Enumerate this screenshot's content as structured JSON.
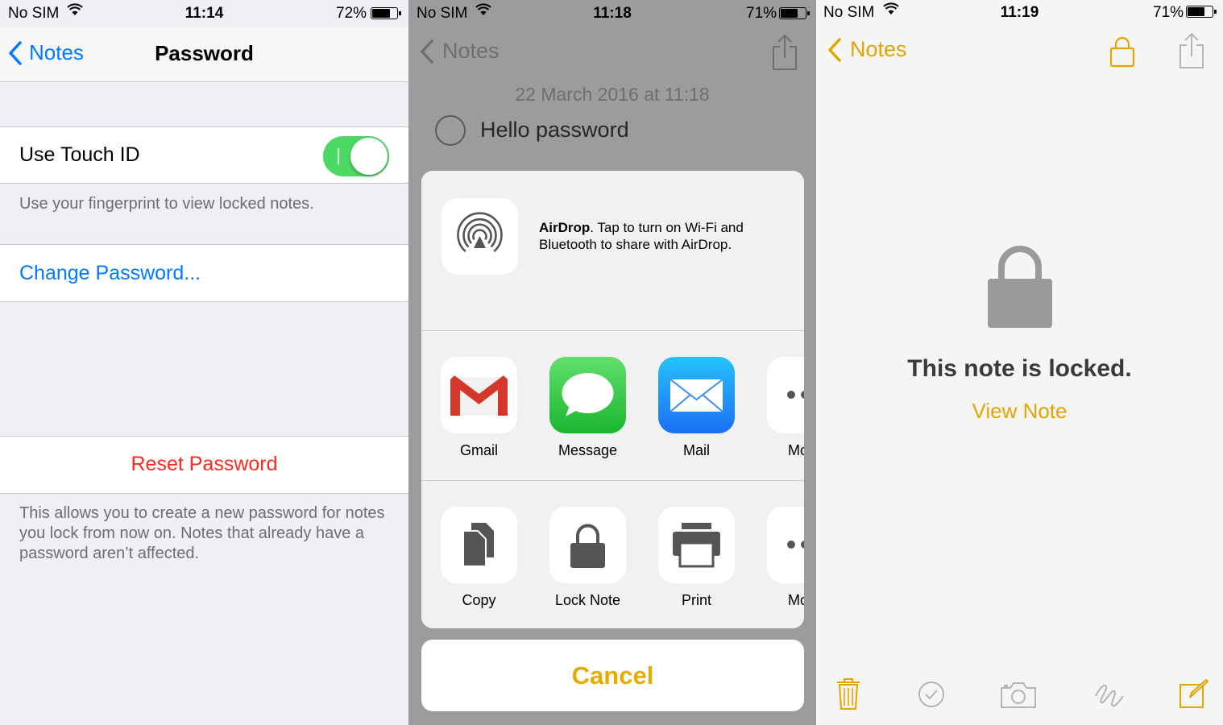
{
  "panel1": {
    "status": {
      "carrier": "No SIM",
      "time": "11:14",
      "battery": "72%"
    },
    "nav": {
      "back": "Notes",
      "title": "Password"
    },
    "touch_id": {
      "label": "Use Touch ID",
      "footnote": "Use your fingerprint to view locked notes."
    },
    "change_password": "Change Password...",
    "reset_password": "Reset Password",
    "reset_footnote": "This allows you to create a new password for notes you lock from now on. Notes that already have a password aren’t affected."
  },
  "panel2": {
    "status": {
      "carrier": "No SIM",
      "time": "11:18",
      "battery": "71%"
    },
    "nav": {
      "back": "Notes"
    },
    "date": "22 March 2016 at 11:18",
    "note_text": "Hello password",
    "airdrop": {
      "title": "AirDrop",
      "message": ". Tap to turn on Wi-Fi and Bluetooth to share with AirDrop."
    },
    "share_apps": [
      {
        "label": "Gmail",
        "icon": "gmail-icon"
      },
      {
        "label": "Message",
        "icon": "messages-icon"
      },
      {
        "label": "Mail",
        "icon": "mail-icon"
      },
      {
        "label": "Mo",
        "icon": "more-icon"
      }
    ],
    "actions": [
      {
        "label": "Copy",
        "icon": "copy-icon"
      },
      {
        "label": "Lock Note",
        "icon": "lock-icon"
      },
      {
        "label": "Print",
        "icon": "print-icon"
      },
      {
        "label": "Mo",
        "icon": "more-icon"
      }
    ],
    "cancel": "Cancel"
  },
  "panel3": {
    "status": {
      "carrier": "No SIM",
      "time": "11:19",
      "battery": "71%"
    },
    "nav": {
      "back": "Notes"
    },
    "locked_title": "This note is locked.",
    "view_note": "View Note",
    "colors": {
      "accent": "#e2a500",
      "toolbar_gray": "#b5b5b5"
    }
  },
  "colors": {
    "ios_blue": "#007aff",
    "ios_red": "#ff3b30",
    "toggle_green": "#4cd964",
    "notes_yellow": "#e5ab00"
  }
}
